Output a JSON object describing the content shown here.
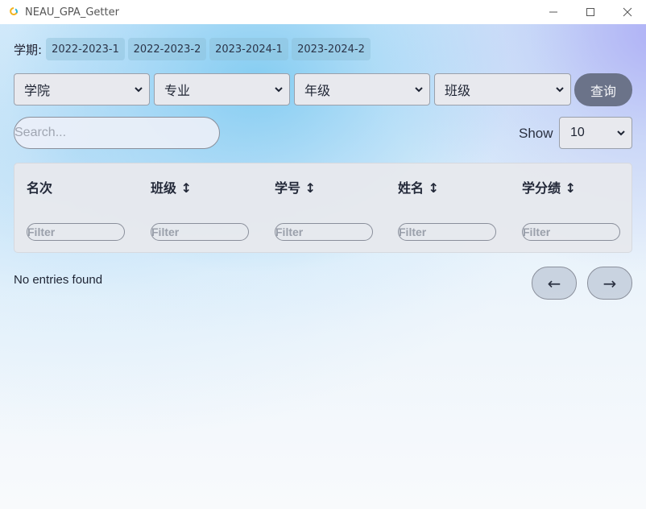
{
  "window": {
    "title": "NEAU_GPA_Getter",
    "minimize": "—",
    "maximize": "☐",
    "close": "✕"
  },
  "term": {
    "label": "学期:",
    "chips": [
      "2022-2023-1",
      "2022-2023-2",
      "2023-2024-1",
      "2023-2024-2"
    ]
  },
  "filters": {
    "college": "学院",
    "major": "专业",
    "grade": "年级",
    "class": "班级",
    "query_button": "查询"
  },
  "search": {
    "placeholder": "Search..."
  },
  "page_size": {
    "label": "Show",
    "value": "10"
  },
  "table": {
    "columns": [
      "名次",
      "班级 ↕",
      "学号 ↕",
      "姓名 ↕",
      "学分绩 ↕"
    ],
    "filter_placeholder": "Filter"
  },
  "status": {
    "empty": "No entries found"
  },
  "pager": {
    "prev": "←",
    "next": "→"
  }
}
